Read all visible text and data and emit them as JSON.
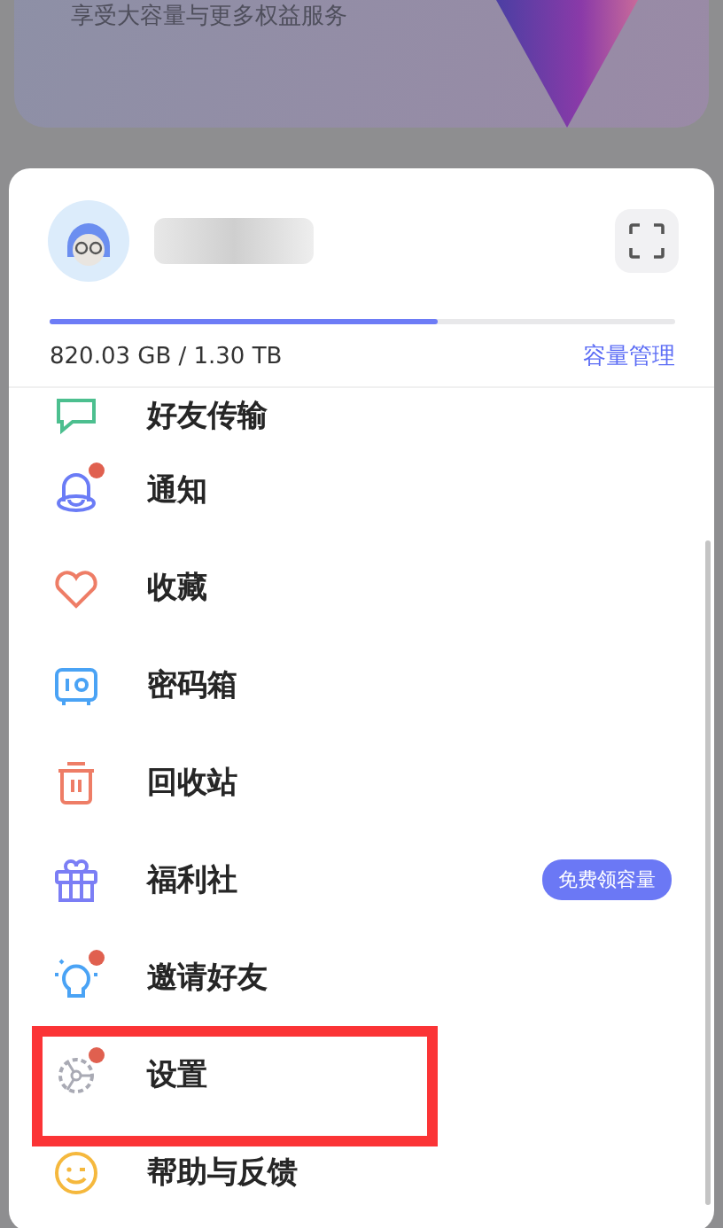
{
  "promo_card": {
    "subtitle": "享受大容量与更多权益服务"
  },
  "account": {
    "level": 0.62,
    "storage_reading": "820.03 GB / 1.30 TB",
    "manage_link": "容量管理"
  },
  "menu": [
    {
      "kind": "chat",
      "label": "好友传输",
      "dot": false,
      "highlighted": false
    },
    {
      "kind": "bell",
      "label": "通知",
      "dot": true,
      "highlighted": false
    },
    {
      "kind": "heart",
      "label": "收藏",
      "dot": false,
      "highlighted": false
    },
    {
      "kind": "safe",
      "label": "密码箱",
      "dot": false,
      "highlighted": false
    },
    {
      "kind": "trash",
      "label": "回收站",
      "dot": false,
      "highlighted": false
    },
    {
      "kind": "gift",
      "label": "福利社",
      "dot": false,
      "highlighted": false,
      "badge": "免费领容量"
    },
    {
      "kind": "bulb",
      "label": "邀请好友",
      "dot": true,
      "highlighted": false
    },
    {
      "kind": "gear",
      "label": "设置",
      "dot": true,
      "highlighted": true
    },
    {
      "kind": "smile",
      "label": "帮助与反馈",
      "dot": false,
      "highlighted": false
    }
  ]
}
